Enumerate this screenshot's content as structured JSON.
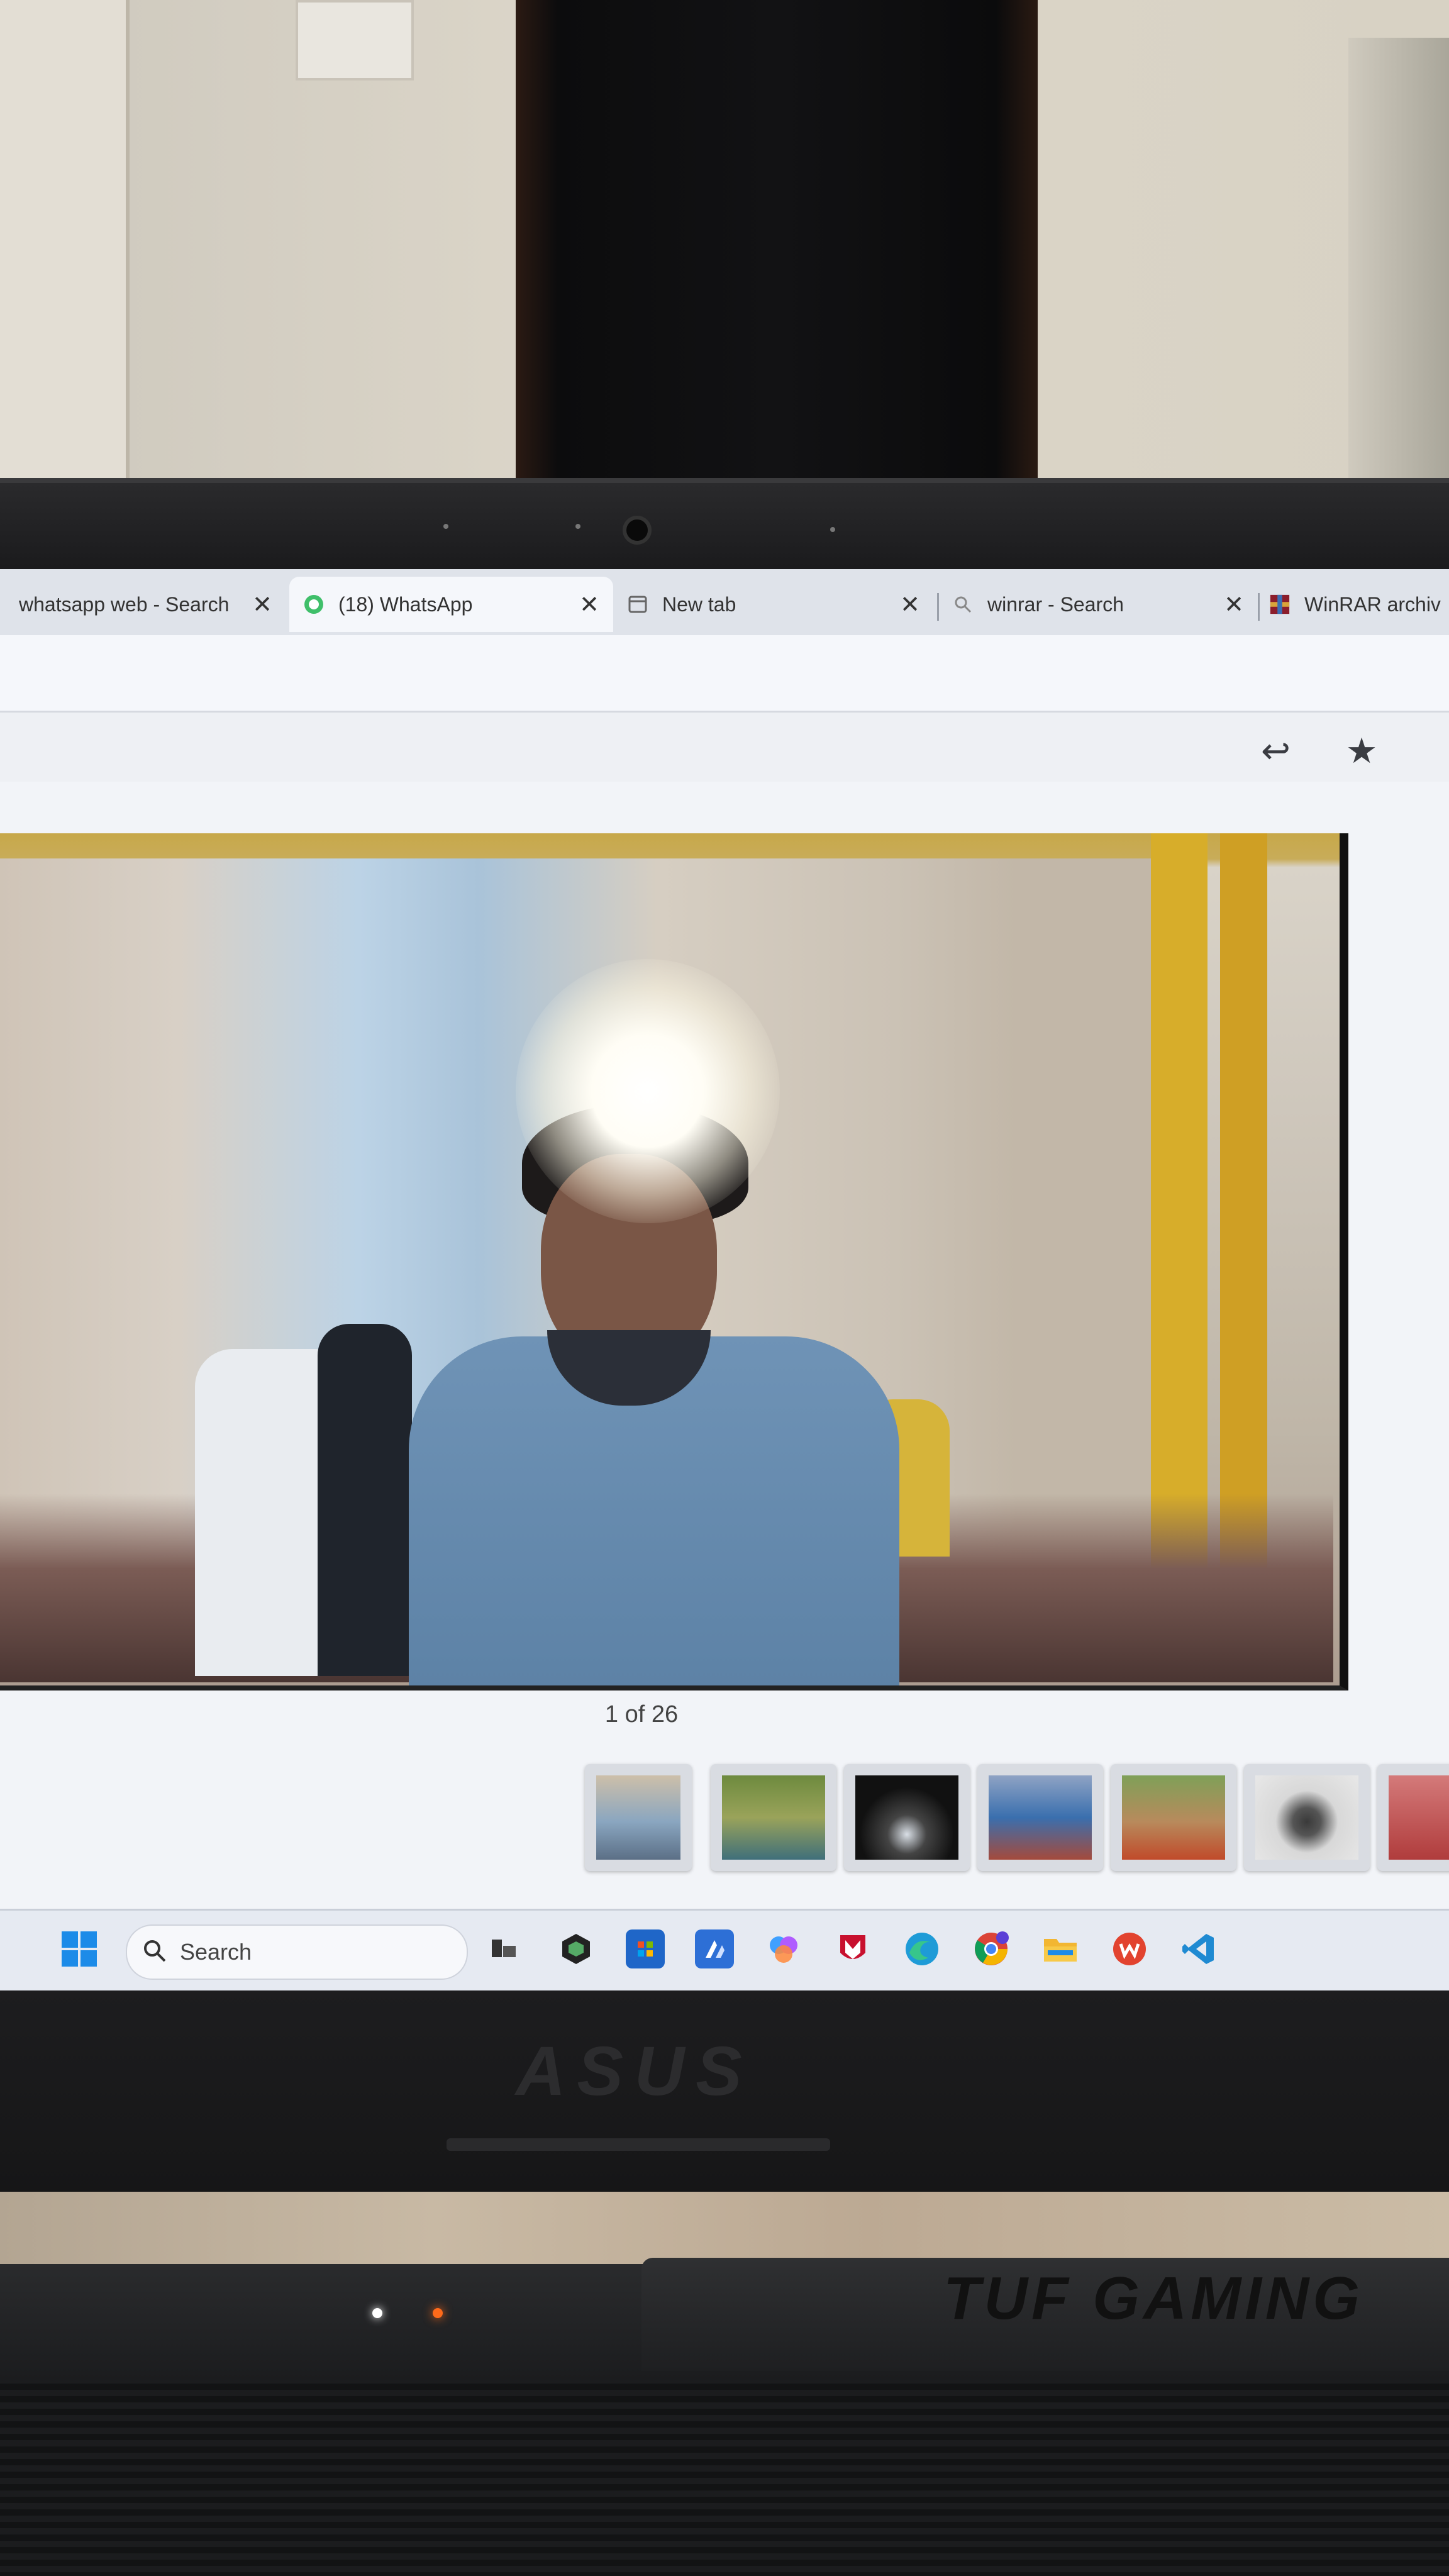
{
  "browser": {
    "tabs": [
      {
        "title": "whatsapp web - Search",
        "icon": "search-icon",
        "active": false
      },
      {
        "title": "(18) WhatsApp",
        "icon": "whatsapp-icon",
        "active": true
      },
      {
        "title": "New tab",
        "icon": "new-tab-icon",
        "active": false
      },
      {
        "title": "winrar - Search",
        "icon": "search-icon",
        "active": false
      },
      {
        "title": "WinRAR archiv",
        "icon": "winrar-icon",
        "active": false
      }
    ],
    "close_glyph": "✕"
  },
  "viewer": {
    "counter": "1 of 26",
    "actions": [
      {
        "name": "reply-icon",
        "glyph": "↩"
      },
      {
        "name": "star-icon",
        "glyph": "★"
      }
    ]
  },
  "taskbar": {
    "search_label": "Search",
    "icons": [
      "windows-start-icon",
      "task-view-icon",
      "app-icon",
      "microsoft-store-icon",
      "app-icon",
      "copilot-icon",
      "mcafee-icon",
      "edge-icon",
      "chrome-icon",
      "file-explorer-icon",
      "wps-office-icon",
      "vscode-icon"
    ]
  },
  "laptop": {
    "lid_brand": "ASUS",
    "base_brand": "TUF GAMING"
  }
}
